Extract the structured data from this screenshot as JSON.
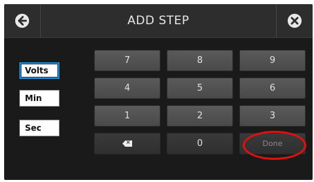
{
  "header": {
    "title": "ADD STEP",
    "back_icon": "back-arrow-icon",
    "close_icon": "close-icon"
  },
  "units": [
    {
      "label": "Volts",
      "selected": true
    },
    {
      "label": "Min",
      "selected": false
    },
    {
      "label": "Sec",
      "selected": false
    }
  ],
  "keypad": {
    "k7": "7",
    "k8": "8",
    "k9": "9",
    "k4": "4",
    "k5": "5",
    "k6": "6",
    "k1": "1",
    "k2": "2",
    "k3": "3",
    "k0": "0",
    "backspace_icon": "backspace-icon",
    "done": "Done"
  },
  "colors": {
    "background": "#1a1a1a",
    "header": "#2d2d2d",
    "key": "#4f4f4f",
    "selected_border": "#1e8fd8",
    "highlight_circle": "#e01010"
  }
}
